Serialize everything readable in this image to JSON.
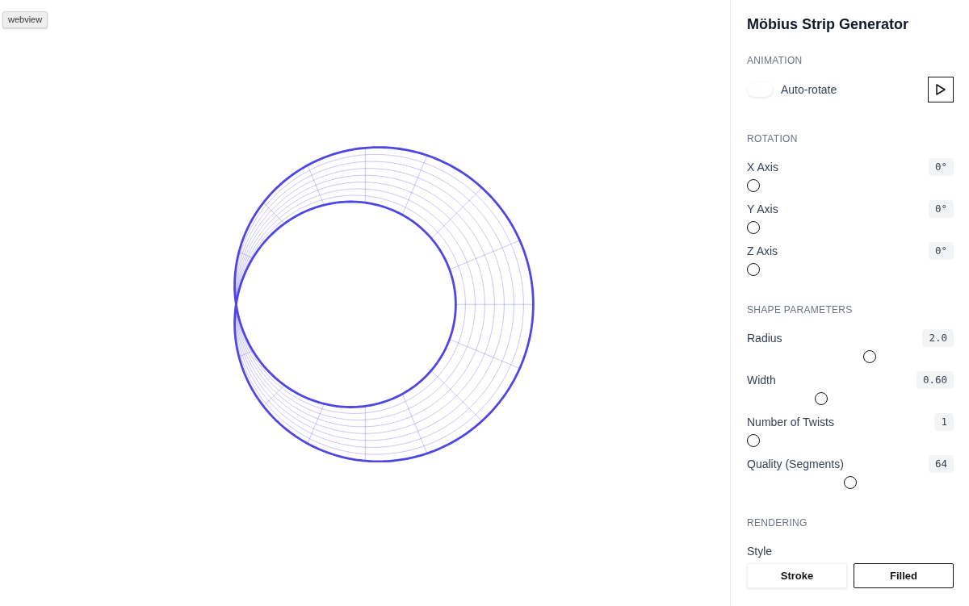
{
  "badge": {
    "label": "webview"
  },
  "panel": {
    "title": "Möbius Strip Generator",
    "sections": [
      {
        "heading": "ANIMATION",
        "controls": [
          {
            "kind": "toggle",
            "label": "Auto-rotate",
            "on": false
          }
        ]
      },
      {
        "heading": "ROTATION",
        "controls": [
          {
            "kind": "slider",
            "label": "X Axis",
            "value": "0°",
            "level": 0
          },
          {
            "kind": "slider",
            "label": "Y Axis",
            "value": "0°",
            "level": 0
          },
          {
            "kind": "slider",
            "label": "Z Axis",
            "value": "0°",
            "level": 0
          }
        ]
      },
      {
        "heading": "SHAPE PARAMETERS",
        "controls": [
          {
            "kind": "slider",
            "label": "Radius",
            "value": "2.0",
            "level": 0.6
          },
          {
            "kind": "slider",
            "label": "Width",
            "value": "0.60",
            "level": 0.35
          },
          {
            "kind": "slider",
            "label": "Number of Twists",
            "value": "1",
            "level": 0
          },
          {
            "kind": "slider",
            "label": "Quality (Segments)",
            "value": "64",
            "level": 0.5
          }
        ]
      },
      {
        "heading": "RENDERING",
        "controls": [
          {
            "kind": "choice",
            "label": "Style",
            "options": [
              {
                "label": "Stroke",
                "selected": false
              },
              {
                "label": "Filled",
                "selected": true
              }
            ]
          }
        ]
      }
    ]
  }
}
